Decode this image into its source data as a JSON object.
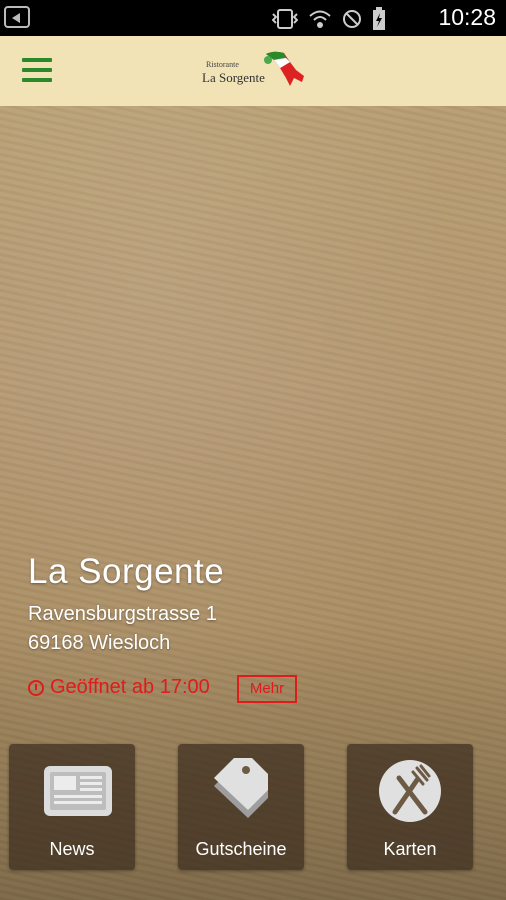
{
  "status": {
    "time": "10:28"
  },
  "restaurant": {
    "name": "La Sorgente",
    "address_line1": "Ravensburgstrasse 1",
    "address_line2": "69168 Wiesloch",
    "open_status": "Geöffnet ab 17:00",
    "more_label": "Mehr"
  },
  "logo": {
    "line1": "Ristorante",
    "line2": "La Sorgente"
  },
  "tiles": [
    {
      "label": "News",
      "icon": "newspaper-icon"
    },
    {
      "label": "Gutscheine",
      "icon": "coupon-icon"
    },
    {
      "label": "Karten",
      "icon": "fork-knife-icon"
    }
  ],
  "colors": {
    "appbar": "#f1e3b6",
    "menu_green": "#2a8a2a",
    "alert_red": "#e01b1b"
  }
}
